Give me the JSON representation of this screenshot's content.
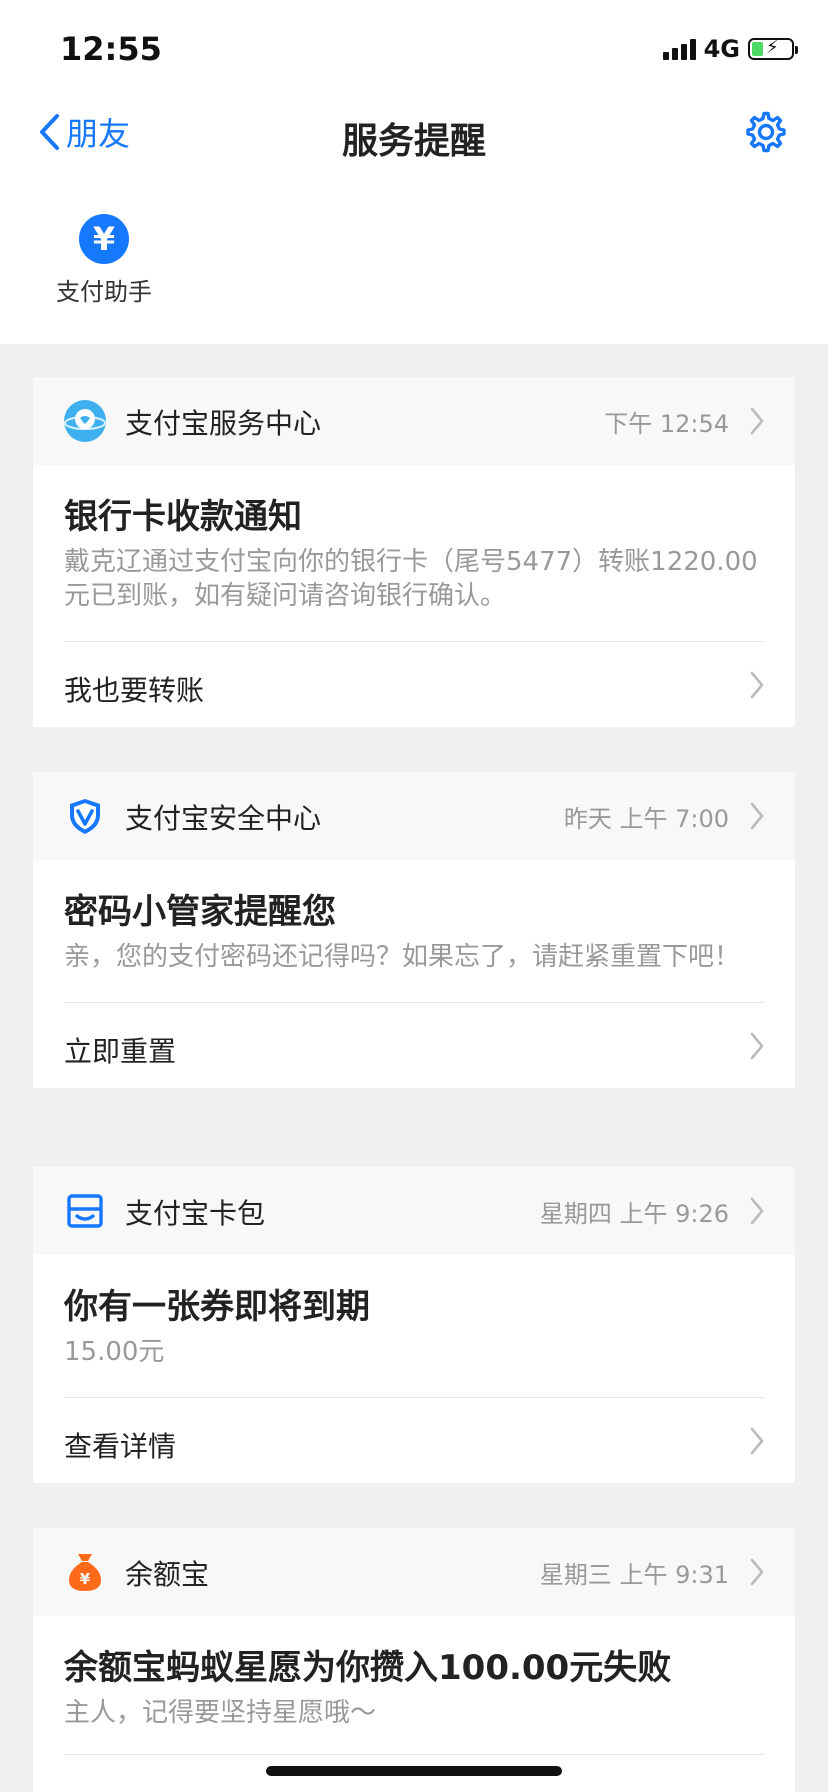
{
  "status": {
    "time": "12:55",
    "network": "4G"
  },
  "nav": {
    "back_label": "朋友",
    "title": "服务提醒"
  },
  "assistant": {
    "label": "支付助手",
    "symbol": "¥"
  },
  "cards": [
    {
      "source": "支付宝服务中心",
      "time": "下午 12:54",
      "title": "银行卡收款通知",
      "desc": "戴克辽通过支付宝向你的银行卡（尾号5477）转账1220.00元已到账，如有疑问请咨询银行确认。",
      "action": "我也要转账",
      "icon": "service-robot-icon"
    },
    {
      "source": "支付宝安全中心",
      "time": "昨天 上午 7:00",
      "title": "密码小管家提醒您",
      "desc": "亲，您的支付密码还记得吗？如果忘了，请赶紧重置下吧！",
      "action": "立即重置",
      "icon": "shield-icon"
    },
    {
      "source": "支付宝卡包",
      "time": "星期四 上午 9:26",
      "title": "你有一张券即将到期",
      "desc": "15.00元",
      "action": "查看详情",
      "icon": "wallet-icon"
    },
    {
      "source": "余额宝",
      "time": "星期三 上午 9:31",
      "title": "余额宝蚂蚁星愿为你攒入100.00元失败",
      "desc": "主人，记得要坚持星愿哦～",
      "icon": "money-bag-icon"
    }
  ],
  "colors": {
    "accent": "#1677ff",
    "orange": "#ff6a1a",
    "background": "#f0f0f0"
  }
}
